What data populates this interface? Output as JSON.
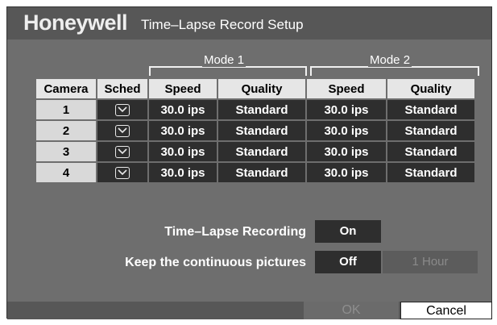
{
  "header": {
    "logo": "Honeywell",
    "title": "Time–Lapse Record Setup"
  },
  "modes": {
    "mode1": "Mode 1",
    "mode2": "Mode 2"
  },
  "columns": [
    "Camera",
    "Sched",
    "Speed",
    "Quality",
    "Speed",
    "Quality"
  ],
  "rows": [
    {
      "camera": "1",
      "sched_checked": true,
      "m1_speed": "30.0 ips",
      "m1_quality": "Standard",
      "m2_speed": "30.0 ips",
      "m2_quality": "Standard"
    },
    {
      "camera": "2",
      "sched_checked": true,
      "m1_speed": "30.0 ips",
      "m1_quality": "Standard",
      "m2_speed": "30.0 ips",
      "m2_quality": "Standard"
    },
    {
      "camera": "3",
      "sched_checked": true,
      "m1_speed": "30.0 ips",
      "m1_quality": "Standard",
      "m2_speed": "30.0 ips",
      "m2_quality": "Standard"
    },
    {
      "camera": "4",
      "sched_checked": true,
      "m1_speed": "30.0 ips",
      "m1_quality": "Standard",
      "m2_speed": "30.0 ips",
      "m2_quality": "Standard"
    }
  ],
  "settings": {
    "time_lapse_label": "Time–Lapse Recording",
    "time_lapse_value": "On",
    "keep_label": "Keep the continuous pictures",
    "keep_value": "Off",
    "keep_duration": "1 Hour"
  },
  "footer": {
    "ok_label": "OK",
    "cancel_label": "Cancel"
  }
}
